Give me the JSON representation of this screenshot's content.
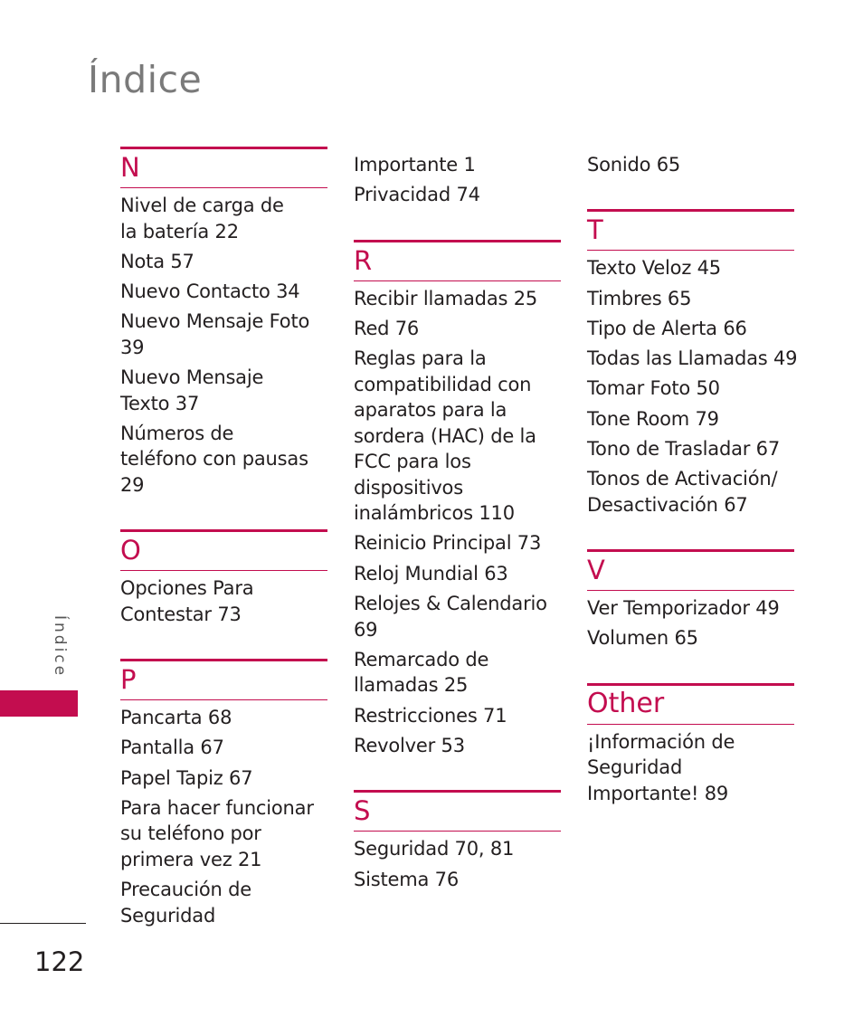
{
  "page": {
    "title": "Índice",
    "side_label": "Índice",
    "page_number": "122",
    "accent_color": "#c30d4f"
  },
  "columns": [
    {
      "lead_entries": [],
      "sections": [
        {
          "letter": "N",
          "entries": [
            "Nivel de carga de la batería 22",
            "Nota 57",
            "Nuevo Contacto 34",
            "Nuevo Mensaje Foto 39",
            "Nuevo Mensaje Texto 37",
            "Números de teléfono con pausas 29"
          ]
        },
        {
          "letter": "O",
          "entries": [
            "Opciones Para Contestar 73"
          ]
        },
        {
          "letter": "P",
          "entries": [
            "Pancarta 68",
            "Pantalla 67",
            "Papel Tapiz 67",
            "Para hacer funcionar su teléfono por primera vez 21",
            "Precaución de Seguridad"
          ]
        }
      ]
    },
    {
      "lead_entries": [
        "Importante 1",
        "Privacidad 74"
      ],
      "sections": [
        {
          "letter": "R",
          "entries": [
            "Recibir llamadas 25",
            "Red 76",
            "Reglas para la compatibilidad con aparatos para la sordera (HAC) de la FCC para los dispositivos inalámbricos 110",
            "Reinicio Principal 73",
            "Reloj Mundial 63",
            "Relojes & Calendario 69",
            "Remarcado de llamadas 25",
            "Restricciones 71",
            "Revolver 53"
          ]
        },
        {
          "letter": "S",
          "entries": [
            "Seguridad 70, 81",
            "Sistema 76"
          ]
        }
      ]
    },
    {
      "lead_entries": [
        "Sonido 65"
      ],
      "sections": [
        {
          "letter": "T",
          "entries": [
            "Texto Veloz 45",
            "Timbres 65",
            "Tipo de Alerta 66",
            "Todas las Llamadas 49",
            "Tomar Foto 50",
            "Tone Room 79",
            "Tono de Trasladar 67",
            "Tonos de Activación/ Desactivación 67"
          ]
        },
        {
          "letter": "V",
          "entries": [
            "Ver Temporizador 49",
            "Volumen 65"
          ]
        },
        {
          "letter": "Other",
          "entries": [
            "¡Información de Seguridad Importante! 89"
          ]
        }
      ]
    }
  ]
}
